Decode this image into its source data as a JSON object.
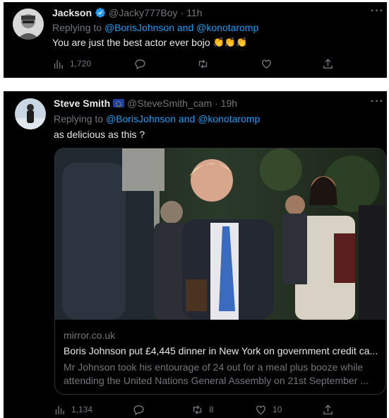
{
  "tweet1": {
    "name": "Jackson",
    "handle": "@Jacky777Boy",
    "time": "· 11h",
    "replying_prefix": "Replying to",
    "replying_mentions": "@BorisJohnson and @konotaromp",
    "text": "You are just the best actor ever bojo",
    "emoji": "👏👏👏",
    "more": "···",
    "views": "1,720",
    "replies": "",
    "retweets": "",
    "likes": ""
  },
  "tweet2": {
    "name": "Steve Smith",
    "handle": "@SteveSmith_cam",
    "time": "· 19h",
    "replying_prefix": "Replying to",
    "replying_mentions": "@BorisJohnson and @konotaromp",
    "text": "as delicious as this ?",
    "more": "···",
    "card": {
      "domain": "mirror.co.uk",
      "title": "Boris Johnson put £4,445 dinner in New York on government credit ca...",
      "desc_line1": "Mr Johnson took his entourage of 24 out for a meal plus booze while",
      "desc_line2": "attending the United Nations General Assembly on 21st September ..."
    },
    "views": "1,134",
    "replies": "",
    "retweets": "8",
    "likes": "10"
  },
  "colors": {
    "background": "#000000",
    "text": "#e7e9ea",
    "muted": "#71767b",
    "link": "#1d9bf0",
    "verified": "#1d9bf0"
  }
}
